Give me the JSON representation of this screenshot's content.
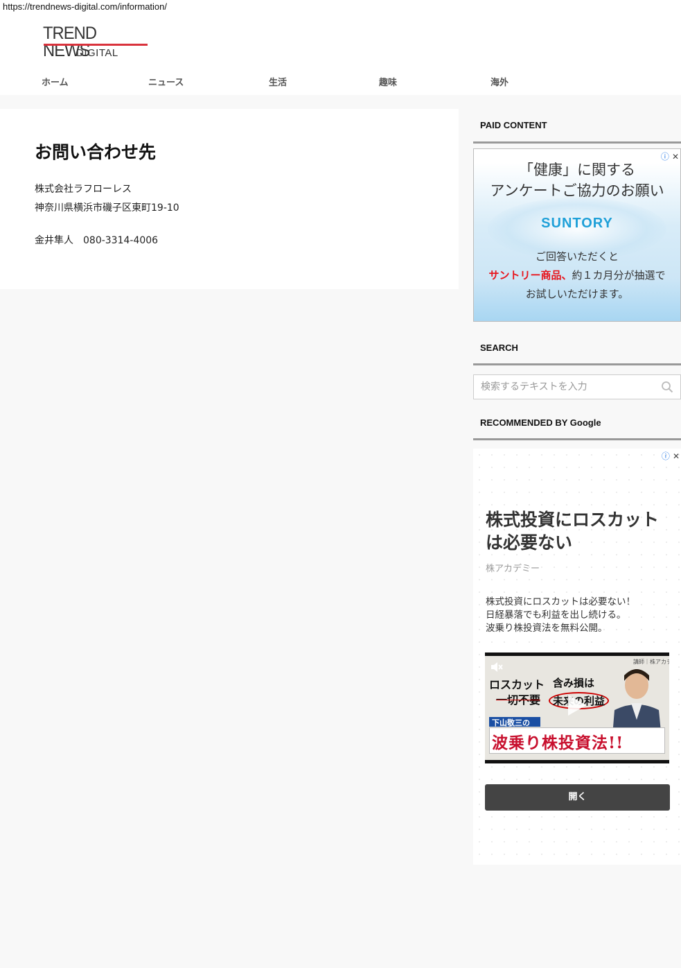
{
  "browser": {
    "url": "https://trendnews-digital.com/information/"
  },
  "logo": {
    "top": "TREND NEWS",
    "bottom": "DIGITAL"
  },
  "nav": [
    {
      "label": "ホーム"
    },
    {
      "label": "ニュース"
    },
    {
      "label": "生活"
    },
    {
      "label": "趣味"
    },
    {
      "label": "海外"
    }
  ],
  "main": {
    "title": "お問い合わせ先",
    "company": "株式会社ラフローレス",
    "address": "神奈川県横浜市磯子区東町19-10",
    "contact": "金井隼人　080-3314-4006"
  },
  "sidebar": {
    "paid_title": "PAID CONTENT",
    "ad1": {
      "line1": "「健康」に関する",
      "line2": "アンケートご協力のお願い",
      "brand": "SUNTORY",
      "line3": "ご回答いただくと",
      "line4_red": "サントリー商品、",
      "line4_rest": "約１カ月分が抽選で",
      "line5": "お試しいただけます。"
    },
    "search_title": "SEARCH",
    "search_placeholder": "検索するテキストを入力",
    "recommended_title": "RECOMMENDED BY Google",
    "ad2": {
      "headline": "株式投資にロスカットは必要ない",
      "advertiser": "株アカデミー",
      "body1": "株式投資にロスカットは必要ない！",
      "body2": "日経暴落でも利益を出し続ける。",
      "body3": "波乗り株投資法を無料公開。",
      "video": {
        "t1": "ロスカット",
        "t2": "一切不要",
        "t3": "含み損は",
        "t4": "未来の利益",
        "t5": "下山敬三の",
        "t6": "波乗り株投資法!!",
        "corner": "講師｜株アカデミー"
      },
      "button": "開く"
    }
  },
  "colors": {
    "accent_red": "#d9323c",
    "suntory_blue": "#1fa0d8",
    "ad_red": "#e8141c"
  }
}
